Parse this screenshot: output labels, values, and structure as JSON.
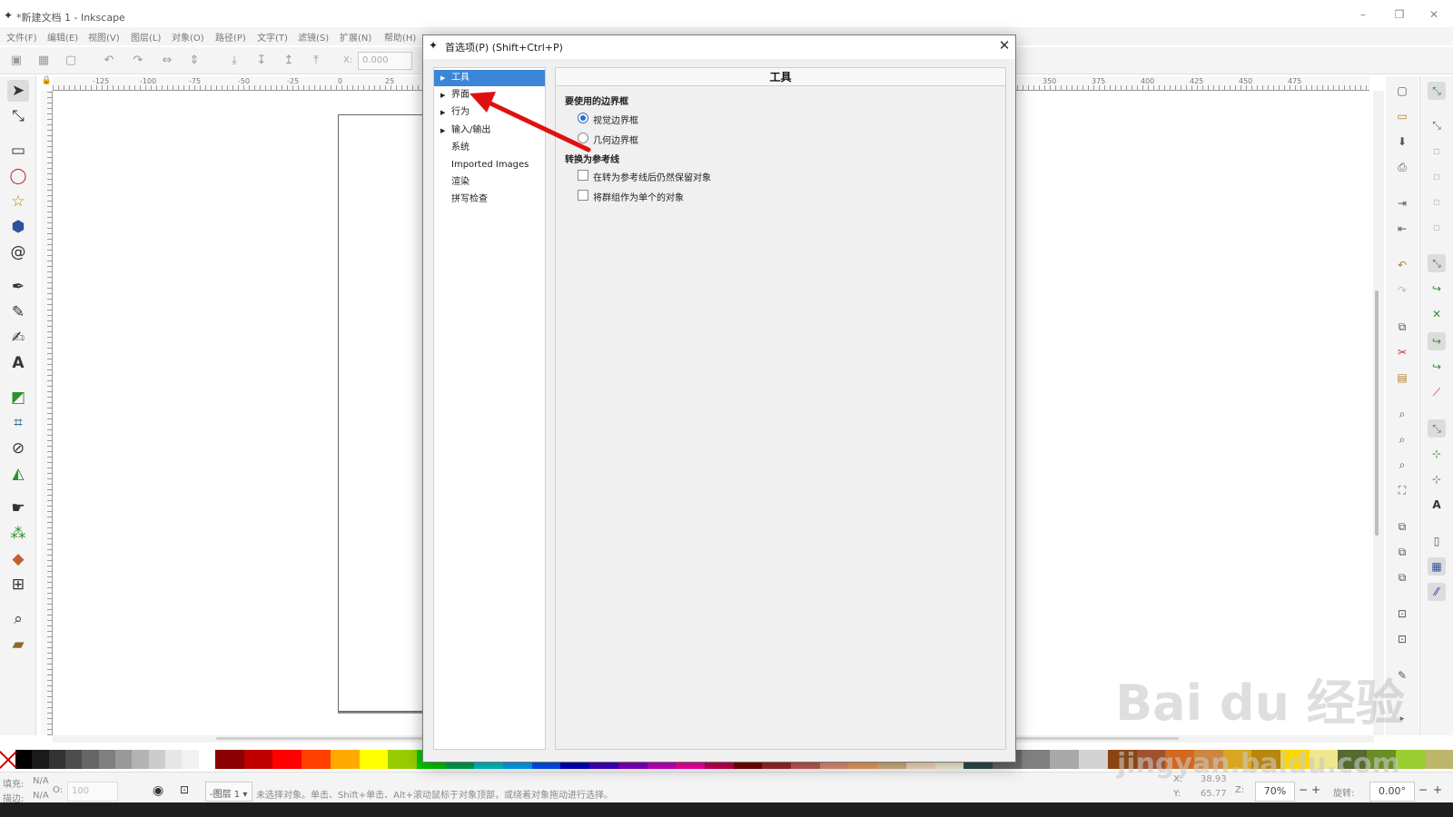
{
  "app": {
    "title": "*新建文档 1 - Inkscape"
  },
  "menu": [
    "文件(F)",
    "编辑(E)",
    "视图(V)",
    "图层(L)",
    "对象(O)",
    "路径(P)",
    "文字(T)",
    "滤镜(S)",
    "扩展(N)",
    "帮助(H)"
  ],
  "toolbar": {
    "x_label": "X:",
    "x_value": "0.000"
  },
  "ruler": {
    "labels": [
      "-125",
      "-100",
      "-75",
      "-50",
      "-25",
      "0",
      "25",
      "350",
      "375",
      "400",
      "425",
      "450",
      "475"
    ]
  },
  "dialog": {
    "title": "首选项(P) (Shift+Ctrl+P)",
    "nav": [
      {
        "label": "工具",
        "expander": "▶",
        "selected": true
      },
      {
        "label": "界面",
        "expander": "▶",
        "selected": false
      },
      {
        "label": "行为",
        "expander": "▶",
        "selected": false
      },
      {
        "label": "输入/输出",
        "expander": "▶",
        "selected": false
      },
      {
        "label": "系统",
        "expander": "",
        "selected": false
      },
      {
        "label": "Imported Images",
        "expander": "",
        "selected": false
      },
      {
        "label": "渲染",
        "expander": "",
        "selected": false
      },
      {
        "label": "拼写检查",
        "expander": "",
        "selected": false
      }
    ],
    "content": {
      "title": "工具",
      "bbox_heading": "要使用的边界框",
      "bbox_options": [
        {
          "label": "视觉边界框",
          "checked": true
        },
        {
          "label": "几何边界框",
          "checked": false
        }
      ],
      "guide_heading": "转换为参考线",
      "guide_options": [
        {
          "label": "在转为参考线后仍然保留对象",
          "checked": false
        },
        {
          "label": "将群组作为单个的对象",
          "checked": false
        }
      ]
    }
  },
  "status": {
    "fill_label": "填充:",
    "fill_value": "N/A",
    "stroke_label": "描边:",
    "stroke_value": "N/A",
    "opacity_label": "O:",
    "opacity_value": "100",
    "layer": "-图层 1",
    "message": "未选择对象。单击、Shift+单击、Alt+滚动鼠标于对象顶部，或绕着对象拖动进行选择。",
    "x_label": "X:",
    "x_value": "38.93",
    "y_label": "Y:",
    "y_value": "65.77",
    "zoom_label": "Z:",
    "zoom_value": "70%",
    "rotate_label": "旋转:",
    "rotate_value": "0.00°"
  },
  "palette": [
    "#8b0000",
    "#c00000",
    "#ff0000",
    "#ff4000",
    "#ffaa00",
    "#ffff00",
    "#99cc00",
    "#00cc00",
    "#00aa55",
    "#00cccc",
    "#00aaff",
    "#0055ff",
    "#0000cc",
    "#4400cc",
    "#8800cc",
    "#cc00cc",
    "#ff00aa",
    "#cc0055",
    "#800000",
    "#a52a2a",
    "#cd5c5c",
    "#e9967a",
    "#f4a460",
    "#deb887",
    "#ffe4c4",
    "#fff8dc",
    "#2f4f4f",
    "#696969",
    "#808080",
    "#a9a9a9",
    "#d3d3d3",
    "#8b4513",
    "#a0522d",
    "#d2691e",
    "#cd853f",
    "#daa520",
    "#b8860b",
    "#ffd700",
    "#f0e68c",
    "#556b2f",
    "#6b8e23",
    "#9acd32",
    "#bdb76b"
  ],
  "grays": [
    "#000000",
    "#1a1a1a",
    "#333333",
    "#4d4d4d",
    "#666666",
    "#808080",
    "#999999",
    "#b3b3b3",
    "#cccccc",
    "#e6e6e6",
    "#f2f2f2",
    "#ffffff"
  ],
  "watermark": {
    "main": "Bai du 经验",
    "url": "jingyan.baidu.com"
  }
}
